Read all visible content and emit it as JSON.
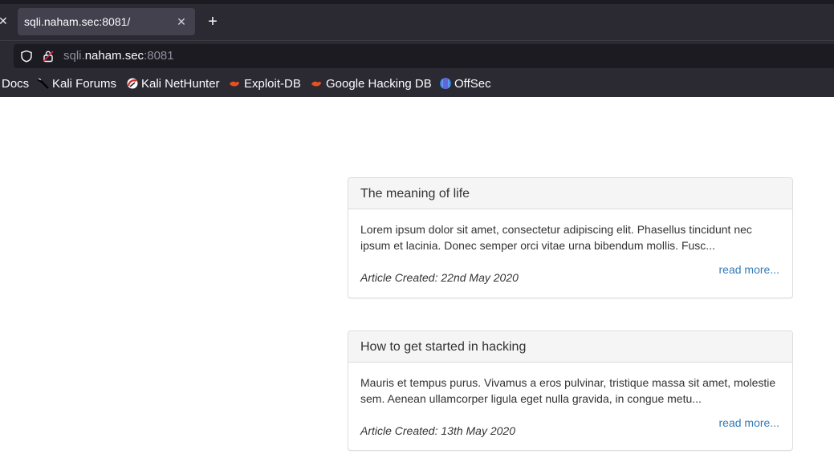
{
  "browser": {
    "tab": {
      "title": "sqli.naham.sec:8081/"
    },
    "url": {
      "prefix": "sqli.",
      "host": "naham.sec",
      "port": ":8081"
    },
    "bookmarks": [
      {
        "label": "Docs",
        "icon": "docs-icon"
      },
      {
        "label": "Kali Forums",
        "icon": "kali-dragon-icon"
      },
      {
        "label": "Kali NetHunter",
        "icon": "nethunter-icon"
      },
      {
        "label": "Exploit-DB",
        "icon": "exploit-db-icon"
      },
      {
        "label": "Google Hacking DB",
        "icon": "ghdb-icon"
      },
      {
        "label": "OffSec",
        "icon": "offsec-icon"
      }
    ]
  },
  "articles": [
    {
      "title": "The meaning of life",
      "excerpt": "Lorem ipsum dolor sit amet, consectetur adipiscing elit. Phasellus tincidunt nec ipsum et lacinia. Donec semper orci vitae urna bibendum mollis. Fusc...",
      "read_more": "read more...",
      "created": "Article Created: 22nd May 2020"
    },
    {
      "title": "How to get started in hacking",
      "excerpt": "Mauris et tempus purus. Vivamus a eros pulvinar, tristique massa sit amet, molestie sem. Aenean ullamcorper ligula eget nulla gravida, in congue metu...",
      "read_more": "read more...",
      "created": "Article Created: 13th May 2020"
    }
  ],
  "colors": {
    "link": "#337ab7",
    "chrome": "#2b2a33",
    "urlbar": "#1c1b22"
  }
}
